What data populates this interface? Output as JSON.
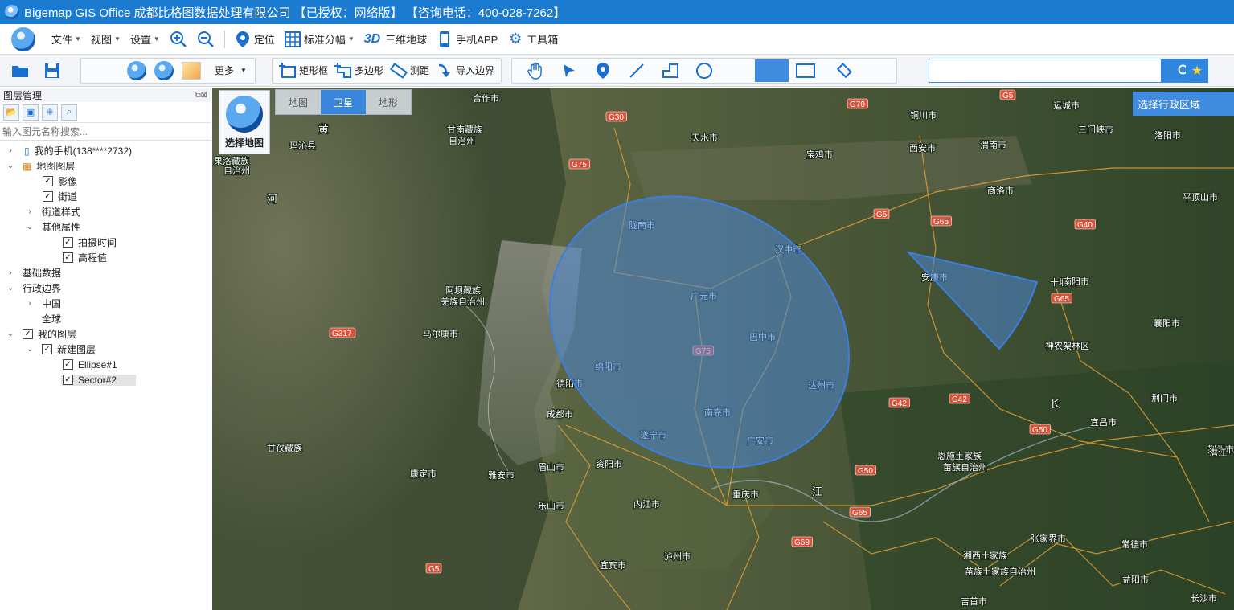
{
  "title": "Bigemap GIS Office 成都比格图数据处理有限公司 【已授权：网络版】 【咨询电话：400-028-7262】",
  "menu": {
    "file": "文件",
    "view": "视图",
    "settings": "设置",
    "locate": "定位",
    "grid": "标准分幅",
    "globe3d_badge": "3D",
    "globe3d": "三维地球",
    "mobile": "手机APP",
    "toolbox": "工具箱"
  },
  "toolbar": {
    "more": "更多",
    "rect": "矩形框",
    "polygon": "多边形",
    "measure": "测距",
    "import": "导入边界"
  },
  "search": {
    "placeholder": ""
  },
  "sidebar": {
    "title": "图层管理",
    "search_placeholder": "输入图元名称搜索...",
    "tree": {
      "phone": "我的手机(138****2732)",
      "map_layers": "地图图层",
      "imagery": "影像",
      "streets": "街道",
      "street_style": "街道样式",
      "other_attrs": "其他属性",
      "capture_time": "拍摄时间",
      "elevation": "高程值",
      "base_data": "基础数据",
      "admin_boundary": "行政边界",
      "china": "中国",
      "world": "全球",
      "my_layers": "我的图层",
      "new_layer": "新建图层",
      "ellipse": "Ellipse#1",
      "sector": "Sector#2"
    }
  },
  "map": {
    "select_map": "选择地图",
    "tabs": [
      "地图",
      "卫星",
      "地形"
    ],
    "active_tab": "卫星",
    "region_button": "选择行政区域",
    "labels": [
      {
        "text": "合作市"
      },
      {
        "text": "甘南藏族"
      },
      {
        "text": "自治州"
      },
      {
        "text": "天水市"
      },
      {
        "text": "宝鸡市"
      },
      {
        "text": "西安市"
      },
      {
        "text": "铜川市"
      },
      {
        "text": "渭南市"
      },
      {
        "text": "运城市"
      },
      {
        "text": "三门峡市"
      },
      {
        "text": "洛阳市"
      },
      {
        "text": "商洛市"
      },
      {
        "text": "平顶山市"
      },
      {
        "text": "陇南市"
      },
      {
        "text": "汉中市"
      },
      {
        "text": "安康市"
      },
      {
        "text": "十堰市"
      },
      {
        "text": "南阳市"
      },
      {
        "text": "广元市"
      },
      {
        "text": "巴中市"
      },
      {
        "text": "阿坝藏族"
      },
      {
        "text": "羌族自治州"
      },
      {
        "text": "马尔康市"
      },
      {
        "text": "绵阳市"
      },
      {
        "text": "德阳市"
      },
      {
        "text": "达州市"
      },
      {
        "text": "成都市"
      },
      {
        "text": "南充市"
      },
      {
        "text": "遂宁市"
      },
      {
        "text": "广安市"
      },
      {
        "text": "襄阳市"
      },
      {
        "text": "神农架林区"
      },
      {
        "text": "荆门市"
      },
      {
        "text": "宜昌市"
      },
      {
        "text": "荆州市"
      },
      {
        "text": "恩施土家族"
      },
      {
        "text": "苗族自治州"
      },
      {
        "text": "甘孜藏族"
      },
      {
        "text": "康定市"
      },
      {
        "text": "雅安市"
      },
      {
        "text": "眉山市"
      },
      {
        "text": "资阳市"
      },
      {
        "text": "乐山市"
      },
      {
        "text": "内江市"
      },
      {
        "text": "重庆市"
      },
      {
        "text": "宜宾市"
      },
      {
        "text": "泸州市"
      },
      {
        "text": "张家界市"
      },
      {
        "text": "常德市"
      },
      {
        "text": "湘西土家族"
      },
      {
        "text": "苗族土家族自治州"
      },
      {
        "text": "益阳市"
      },
      {
        "text": "长沙市"
      },
      {
        "text": "吉首市"
      },
      {
        "text": "玛沁县"
      },
      {
        "text": "果洛藏族"
      },
      {
        "text": "自治州"
      },
      {
        "text": "潜江"
      },
      {
        "text": "黄"
      },
      {
        "text": "河"
      },
      {
        "text": "长"
      },
      {
        "text": "江"
      }
    ],
    "highways": [
      "G30",
      "G70",
      "G5",
      "G75",
      "G5",
      "G65",
      "G40",
      "G65",
      "G317",
      "G75",
      "G42",
      "G42",
      "G50",
      "G50",
      "G65",
      "G69",
      "G5"
    ]
  },
  "colors": {
    "title_bg": "#1b7bd1",
    "accent": "#2e86de",
    "shape_fill": "#4a86d6",
    "shape_stroke": "#3d7fe0"
  }
}
